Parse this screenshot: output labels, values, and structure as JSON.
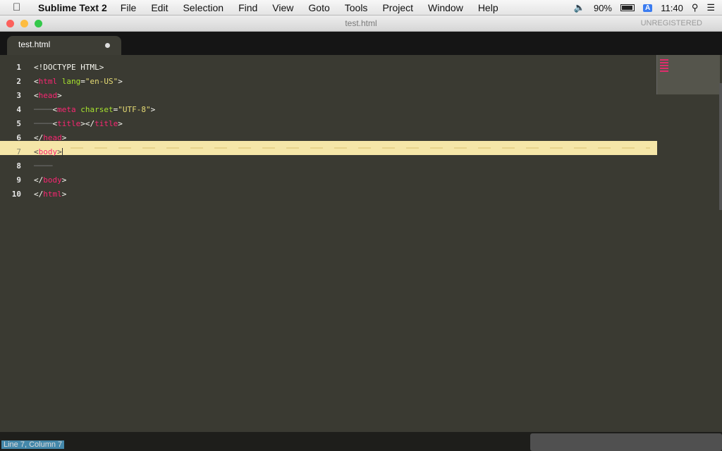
{
  "menubar": {
    "app_name": "Sublime Text 2",
    "items": [
      "File",
      "Edit",
      "Selection",
      "Find",
      "View",
      "Goto",
      "Tools",
      "Project",
      "Window",
      "Help"
    ],
    "battery": "90%",
    "input_source": "A",
    "clock": "11:40"
  },
  "window": {
    "title": "test.html",
    "unregistered": "UNREGISTERED"
  },
  "tab": {
    "label": "test.html"
  },
  "editor": {
    "line_numbers": [
      "1",
      "2",
      "3",
      "4",
      "5",
      "6",
      "7",
      "8",
      "9",
      "10"
    ],
    "current_line": "7",
    "lines": [
      [
        {
          "t": "punc",
          "v": "<!DOCTYPE HTML>"
        }
      ],
      [
        {
          "t": "punc",
          "v": "<"
        },
        {
          "t": "tag",
          "v": "html"
        },
        {
          "t": "punc",
          "v": " "
        },
        {
          "t": "attr",
          "v": "lang"
        },
        {
          "t": "punc",
          "v": "="
        },
        {
          "t": "str",
          "v": "\"en-US\""
        },
        {
          "t": "punc",
          "v": ">"
        }
      ],
      [
        {
          "t": "punc",
          "v": "<"
        },
        {
          "t": "tag",
          "v": "head"
        },
        {
          "t": "punc",
          "v": ">"
        }
      ],
      [
        {
          "t": "indent",
          "v": "────"
        },
        {
          "t": "punc",
          "v": "<"
        },
        {
          "t": "tag",
          "v": "meta"
        },
        {
          "t": "punc",
          "v": " "
        },
        {
          "t": "attr",
          "v": "charset"
        },
        {
          "t": "punc",
          "v": "="
        },
        {
          "t": "str",
          "v": "\"UTF-8\""
        },
        {
          "t": "punc",
          "v": ">"
        }
      ],
      [
        {
          "t": "indent",
          "v": "────"
        },
        {
          "t": "punc",
          "v": "<"
        },
        {
          "t": "tag",
          "v": "title"
        },
        {
          "t": "punc",
          "v": "></"
        },
        {
          "t": "tag",
          "v": "title"
        },
        {
          "t": "punc",
          "v": ">"
        }
      ],
      [
        {
          "t": "punc",
          "v": "</"
        },
        {
          "t": "tag",
          "v": "head"
        },
        {
          "t": "punc",
          "v": ">"
        }
      ],
      [
        {
          "t": "punc",
          "v": "<"
        },
        {
          "t": "tag",
          "v": "body"
        },
        {
          "t": "punc",
          "v": ">"
        }
      ],
      [
        {
          "t": "indent",
          "v": "────"
        }
      ],
      [
        {
          "t": "punc",
          "v": "</"
        },
        {
          "t": "tag",
          "v": "body"
        },
        {
          "t": "punc",
          "v": ">"
        }
      ],
      [
        {
          "t": "punc",
          "v": "</"
        },
        {
          "t": "tag",
          "v": "html"
        },
        {
          "t": "punc",
          "v": ">"
        }
      ]
    ]
  },
  "statusbar": {
    "text": "Line 7, Column 7"
  }
}
